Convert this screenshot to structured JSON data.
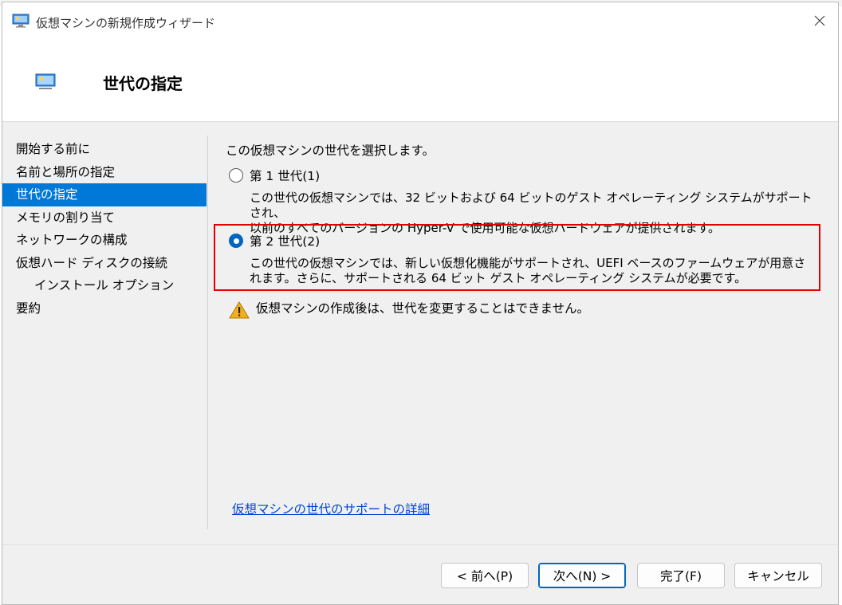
{
  "window": {
    "title": "仮想マシンの新規作成ウィザード"
  },
  "header": {
    "title": "世代の指定"
  },
  "sidebar": {
    "items": [
      {
        "label": "開始する前に"
      },
      {
        "label": "名前と場所の指定"
      },
      {
        "label": "世代の指定"
      },
      {
        "label": "メモリの割り当て"
      },
      {
        "label": "ネットワークの構成"
      },
      {
        "label": "仮想ハード ディスクの接続"
      },
      {
        "label": "インストール オプション"
      },
      {
        "label": "要約"
      }
    ],
    "active_index": 2
  },
  "content": {
    "intro": "この仮想マシンの世代を選択します。",
    "gen1": {
      "label": "第 1 世代(1)",
      "checked": false,
      "desc_line1": "この世代の仮想マシンでは、32 ビットおよび 64 ビットのゲスト オペレーティング システムがサポートされ、",
      "desc_line2": "以前のすべてのバージョンの Hyper-V で使用可能な仮想ハードウェアが提供されます。"
    },
    "gen2": {
      "label": "第 2 世代(2)",
      "checked": true,
      "desc_line1": "この世代の仮想マシンでは、新しい仮想化機能がサポートされ、UEFI ベースのファームウェアが用意さ",
      "desc_line2": "れます。さらに、サポートされる 64 ビット ゲスト オペレーティング システムが必要です。"
    },
    "warning": "仮想マシンの作成後は、世代を変更することはできません。",
    "link": "仮想マシンの世代のサポートの詳細"
  },
  "buttons": {
    "prev": "< 前へ(P)",
    "next": "次へ(N) >",
    "finish": "完了(F)",
    "cancel": "キャンセル"
  },
  "colors": {
    "accent": "#0078d7",
    "highlight": "#e30000",
    "link": "#0046d5",
    "warning": "#f2b01e"
  }
}
